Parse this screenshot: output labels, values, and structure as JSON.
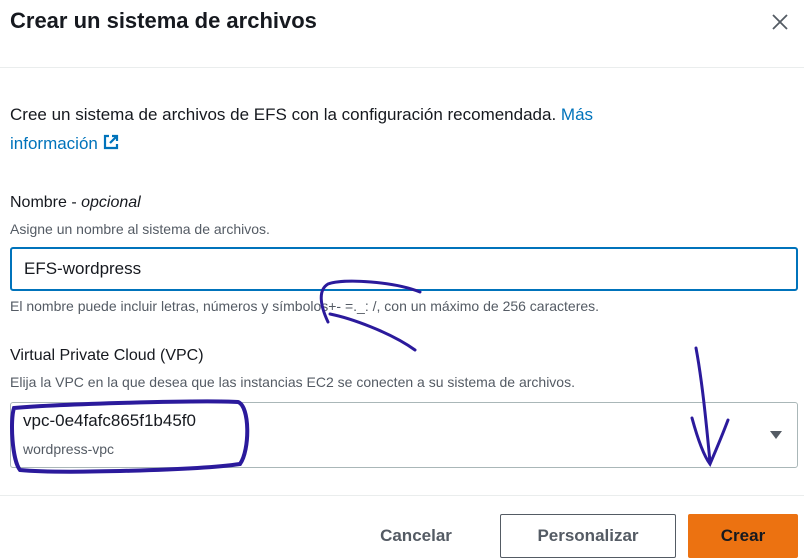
{
  "dialog": {
    "title": "Crear un sistema de archivos",
    "intro_text": "Cree un sistema de archivos de EFS con la configuración recomendada.",
    "more_info_line1": "Más",
    "more_info_line2": "información"
  },
  "name_field": {
    "label": "Nombre - ",
    "label_optional": "opcional",
    "description": "Asigne un nombre al sistema de archivos.",
    "value": "EFS-wordpress",
    "constraint": "El nombre puede incluir letras, números y símbolos+- =._: /, con un máximo de 256 caracteres."
  },
  "vpc_field": {
    "label": "Virtual Private Cloud (VPC)",
    "description": "Elija la VPC en la que desea que las instancias EC2 se conecten a su sistema de archivos.",
    "selected_id": "vpc-0e4fafc865f1b45f0",
    "selected_name": "wordpress-vpc"
  },
  "footer": {
    "cancel_label": "Cancelar",
    "customize_label": "Personalizar",
    "create_label": "Crear"
  },
  "colors": {
    "accent_link": "#0073bb",
    "primary_button": "#ec7211",
    "annotation_ink": "#2b1a9c"
  },
  "icons": [
    "close-icon",
    "external-link-icon",
    "caret-down-icon"
  ]
}
